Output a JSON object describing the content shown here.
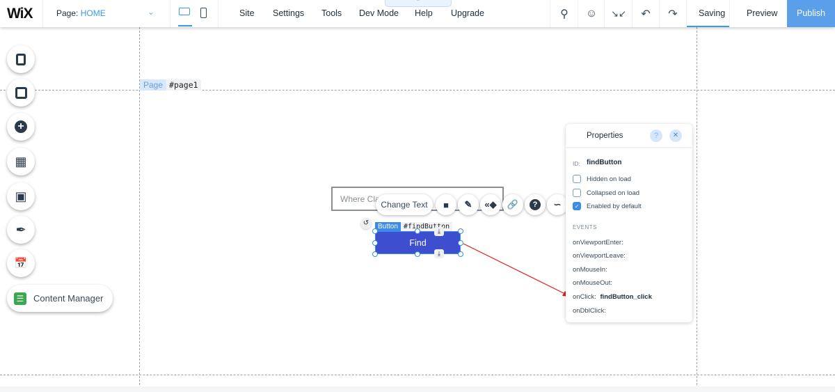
{
  "topbar": {
    "logo": "WiX",
    "page_prefix": "Page:",
    "page_name": "HOME",
    "menu": [
      "Site",
      "Settings",
      "Tools",
      "Dev Mode",
      "Help",
      "Upgrade"
    ],
    "saving": "Saving",
    "preview": "Preview",
    "publish": "Publish"
  },
  "colors": {
    "accent": "#3899ec",
    "publish": "#5b9ee9",
    "find_button": "#3d4fcf",
    "arrow": "#e0201c"
  },
  "canvas": {
    "page_tag": "Page",
    "page_id": "#page1",
    "input_placeholder": "Where Cla",
    "change_text": "Change Text",
    "element_type": "Button",
    "element_id": "#findButton",
    "button_label": "Find"
  },
  "sidebar": {
    "items": [
      "pages-icon",
      "background-icon",
      "add-icon",
      "add-apps-icon",
      "media-icon",
      "blog-icon",
      "bookings-icon"
    ],
    "content_manager": "Content Manager"
  },
  "properties": {
    "title": "Properties",
    "help": "?",
    "close": "✕",
    "id_label": "ID:",
    "id_value": "findButton",
    "options": [
      {
        "label": "Hidden on load",
        "checked": false
      },
      {
        "label": "Collapsed on load",
        "checked": false
      },
      {
        "label": "Enabled by default",
        "checked": true
      }
    ],
    "events_heading": "EVENTS",
    "events": [
      {
        "name": "onViewportEnter:",
        "handler": ""
      },
      {
        "name": "onViewportLeave:",
        "handler": ""
      },
      {
        "name": "onMouseIn:",
        "handler": ""
      },
      {
        "name": "onMouseOut:",
        "handler": ""
      },
      {
        "name": "onClick:",
        "handler": "findButton_click"
      },
      {
        "name": "onDblClick:",
        "handler": ""
      }
    ]
  }
}
